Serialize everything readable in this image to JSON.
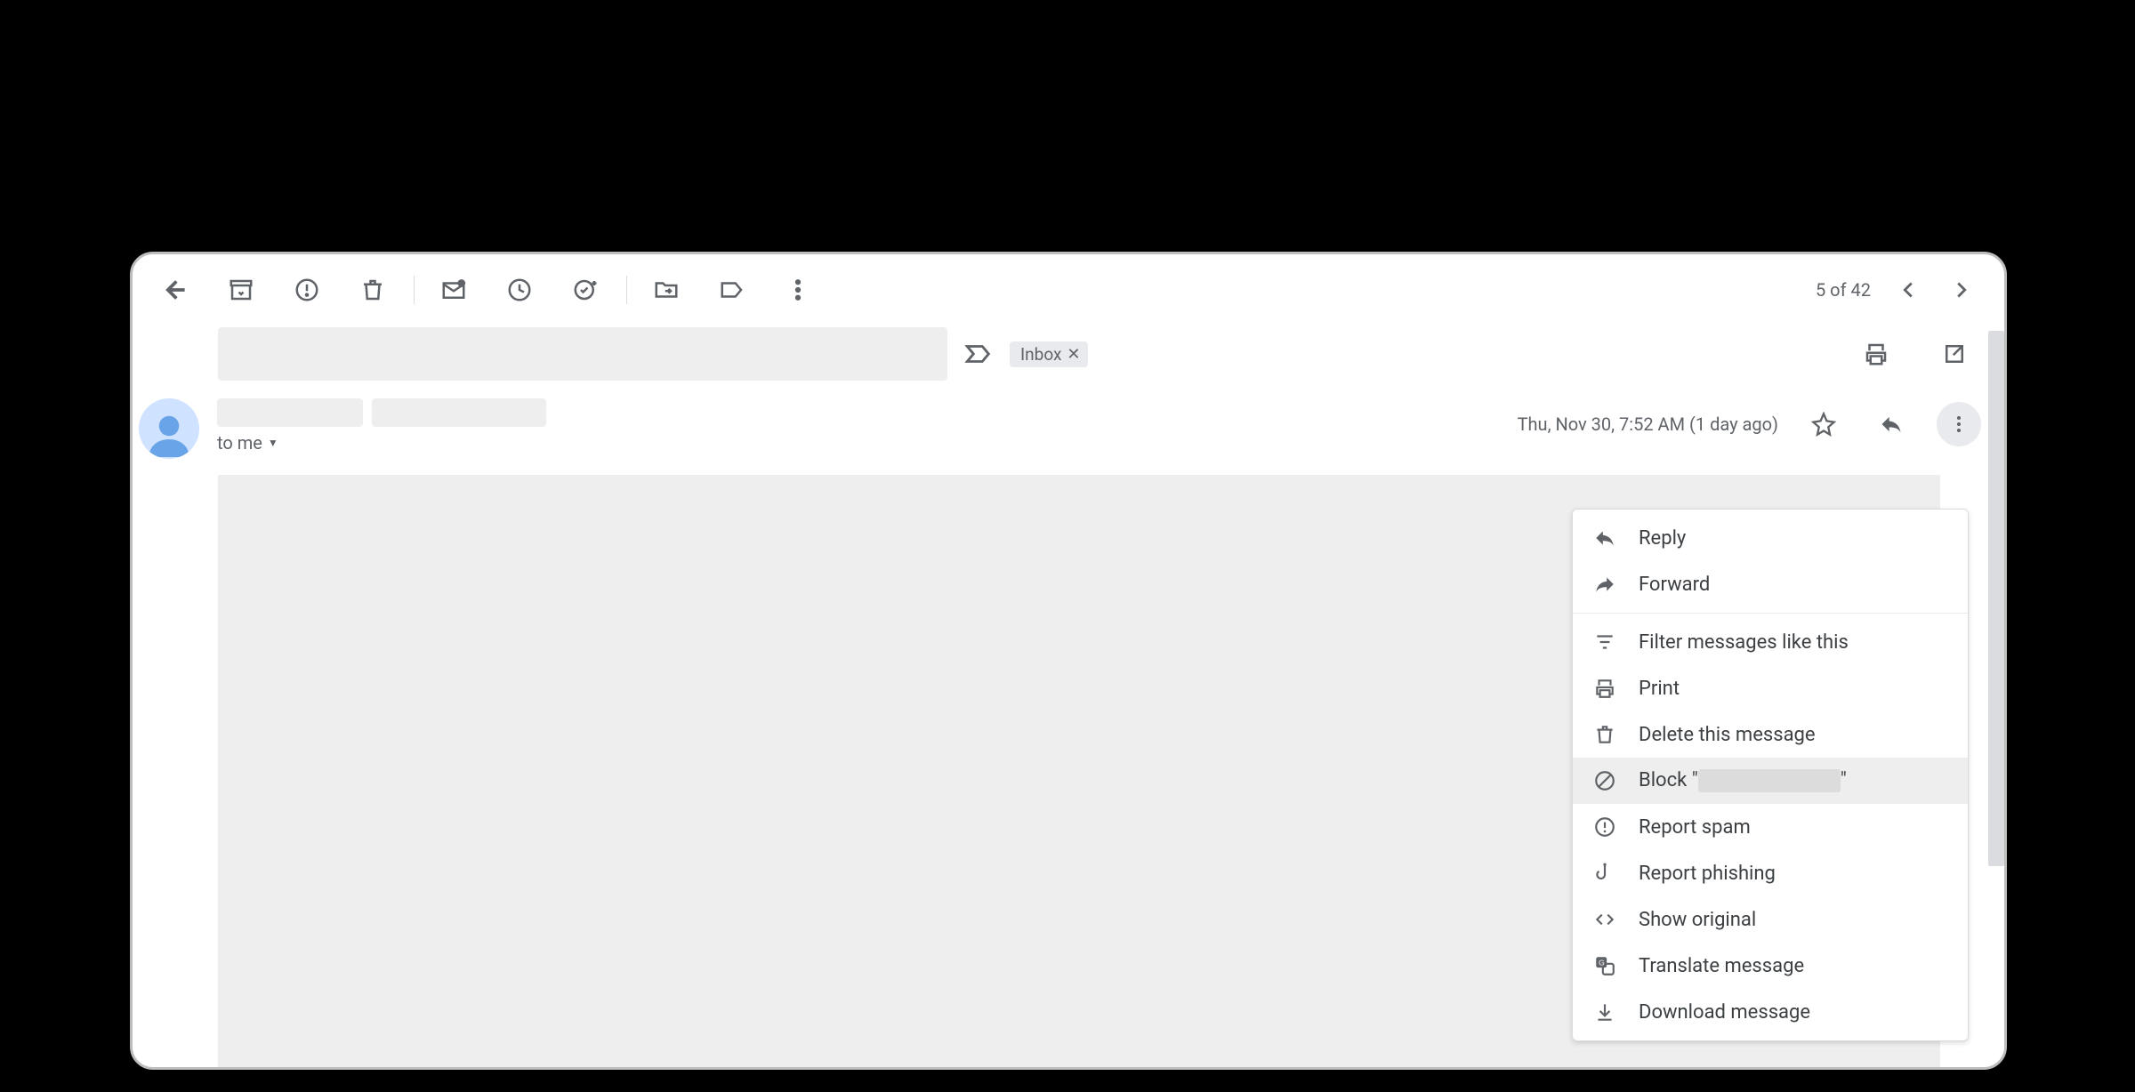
{
  "toolbar": {
    "pager": {
      "text": "5 of 42"
    }
  },
  "subject": {
    "label_chip": "Inbox"
  },
  "sender": {
    "to_line": "to me",
    "timestamp": "Thu, Nov 30, 7:52 AM (1 day ago)"
  },
  "menu": {
    "items": [
      {
        "label": "Reply",
        "icon": "reply-icon"
      },
      {
        "label": "Forward",
        "icon": "forward-icon"
      },
      {
        "sep": true
      },
      {
        "label": "Filter messages like this",
        "icon": "filter-icon"
      },
      {
        "label": "Print",
        "icon": "print-icon"
      },
      {
        "label": "Delete this message",
        "icon": "trash-icon"
      },
      {
        "label_prefix": "Block \"",
        "label_suffix": "\"",
        "icon": "block-icon",
        "hover": true
      },
      {
        "label": "Report spam",
        "icon": "spam-icon"
      },
      {
        "label": "Report phishing",
        "icon": "phishing-icon"
      },
      {
        "label": "Show original",
        "icon": "code-icon"
      },
      {
        "label": "Translate message",
        "icon": "translate-icon"
      },
      {
        "label": "Download message",
        "icon": "download-icon"
      }
    ]
  }
}
